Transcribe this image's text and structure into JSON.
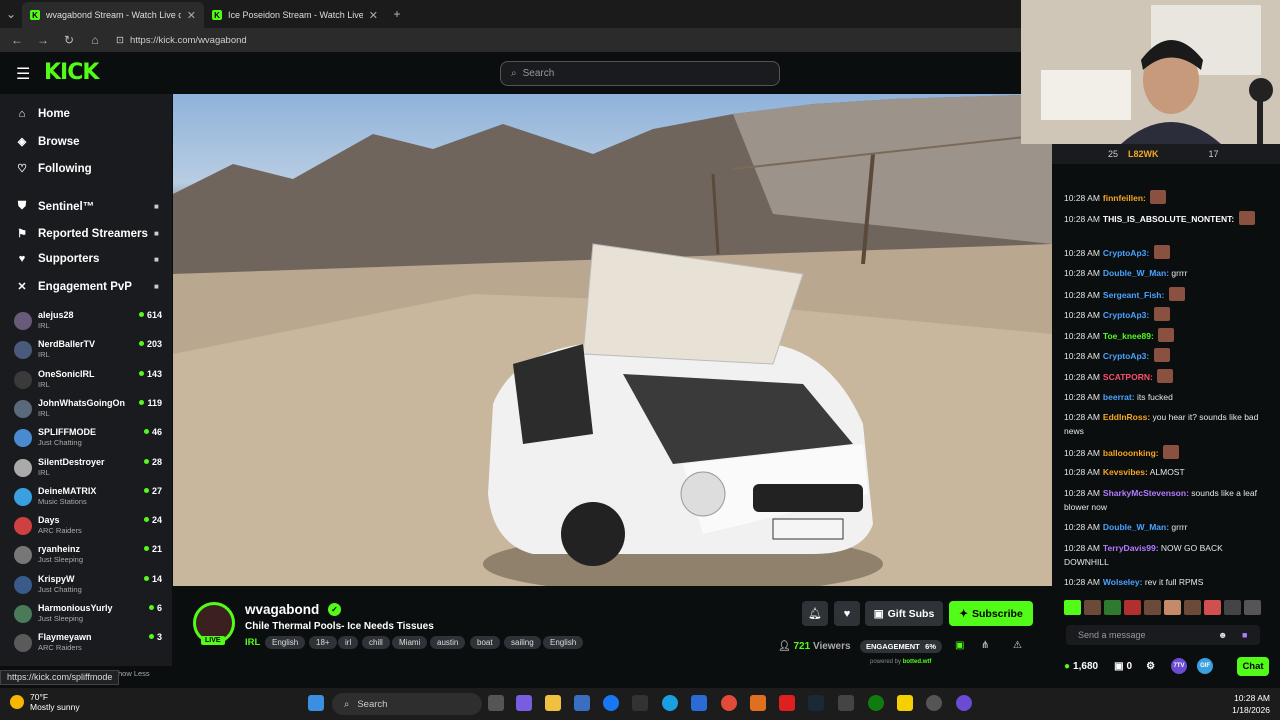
{
  "browser": {
    "tabs": [
      {
        "title": "wvagabond Stream - Watch Live on Kick",
        "active": true
      },
      {
        "title": "Ice Poseidon Stream - Watch Live on Kick",
        "active": false
      }
    ],
    "new_tab": "+",
    "url": "https://kick.com/wvagabond"
  },
  "header": {
    "logo": "KICK",
    "search_placeholder": "Search"
  },
  "sidebar": {
    "nav": [
      {
        "label": "Home",
        "icon": "home-icon"
      },
      {
        "label": "Browse",
        "icon": "compass-icon"
      },
      {
        "label": "Following",
        "icon": "heart-icon"
      }
    ],
    "extensions": [
      {
        "label": "Sentinel™",
        "icon": "shield-icon"
      },
      {
        "label": "Reported Streamers",
        "icon": "flag-icon"
      },
      {
        "label": "Supporters",
        "icon": "heart-icon"
      },
      {
        "label": "Engagement PvP",
        "icon": "swords-icon"
      }
    ],
    "channels": [
      {
        "name": "alejus28",
        "category": "IRL",
        "viewers": "614"
      },
      {
        "name": "NerdBallerTV",
        "category": "IRL",
        "viewers": "203"
      },
      {
        "name": "OneSonicIRL",
        "category": "IRL",
        "viewers": "143"
      },
      {
        "name": "JohnWhatsGoingOn",
        "category": "IRL",
        "viewers": "119"
      },
      {
        "name": "SPLIFFMODE",
        "category": "Just Chatting",
        "viewers": "46"
      },
      {
        "name": "SilentDestroyer",
        "category": "IRL",
        "viewers": "28"
      },
      {
        "name": "DeineMATRIX",
        "category": "Music Stations",
        "viewers": "27"
      },
      {
        "name": "Days",
        "category": "ARC Raiders",
        "viewers": "24"
      },
      {
        "name": "ryanheinz",
        "category": "Just Sleeping",
        "viewers": "21"
      },
      {
        "name": "KrispyW",
        "category": "Just Chatting",
        "viewers": "14"
      },
      {
        "name": "HarmoniousYurly",
        "category": "Just Sleeping",
        "viewers": "6"
      },
      {
        "name": "Flaymeyawn",
        "category": "ARC Raiders",
        "viewers": "3"
      }
    ],
    "show_less": "how Less"
  },
  "stream": {
    "streamer": "wvagabond",
    "live_badge": "LIVE",
    "title": "Chile Thermal Pools- Ice Needs Tissues",
    "category": "IRL",
    "tags": [
      "English",
      "18+",
      "irl",
      "chill",
      "Miami",
      "austin",
      "boat",
      "sailing",
      "English"
    ],
    "gift_subs_label": "Gift Subs",
    "subscribe_label": "Subscribe",
    "viewers_count": "721",
    "viewers_label": "Viewers",
    "engagement_label": "ENGAGEMENT",
    "engagement_value": "6%",
    "powered_by_prefix": "powered by",
    "powered_by_brand": "botted.wtf"
  },
  "chat": {
    "top_bar": {
      "left_count": "25",
      "top_gifter": "L82WK",
      "right_count": "17"
    },
    "messages": [
      {
        "time": "10:28 AM",
        "user": "finnfeillen:",
        "text": "",
        "color": "#f5a623"
      },
      {
        "time": "10:28 AM",
        "user": "THIS_IS_ABSOLUTE_NONTENT:",
        "text": "",
        "color": "#ffffff"
      },
      {
        "time": "10:28 AM",
        "user": "CryptoAp3:",
        "text": "",
        "color": "#4aa3ff"
      },
      {
        "time": "10:28 AM",
        "user": "Double_W_Man:",
        "text": "grrrr",
        "color": "#4aa3ff"
      },
      {
        "time": "10:28 AM",
        "user": "Sergeant_Fish:",
        "text": "",
        "color": "#4aa3ff"
      },
      {
        "time": "10:28 AM",
        "user": "CryptoAp3:",
        "text": "",
        "color": "#4aa3ff"
      },
      {
        "time": "10:28 AM",
        "user": "Toe_knee89:",
        "text": "",
        "color": "#53fc18"
      },
      {
        "time": "10:28 AM",
        "user": "CryptoAp3:",
        "text": "",
        "color": "#4aa3ff"
      },
      {
        "time": "10:28 AM",
        "user": "SCATPORN:",
        "text": "",
        "color": "#ff4d6d"
      },
      {
        "time": "10:28 AM",
        "user": "beerrat:",
        "text": "its fucked",
        "color": "#4aa3ff"
      },
      {
        "time": "10:28 AM",
        "user": "EddInRoss:",
        "text": "you hear it? sounds like bad news",
        "color": "#f5a623"
      },
      {
        "time": "10:28 AM",
        "user": "ballooonking:",
        "text": "",
        "color": "#f5a623"
      },
      {
        "time": "10:28 AM",
        "user": "Kevsvibes:",
        "text": "ALMOST",
        "color": "#f5a623"
      },
      {
        "time": "10:28 AM",
        "user": "SharkyMcStevenson:",
        "text": "sounds like a leaf blower now",
        "color": "#b57bff"
      },
      {
        "time": "10:28 AM",
        "user": "Double_W_Man:",
        "text": "grrrr",
        "color": "#4aa3ff"
      },
      {
        "time": "10:28 AM",
        "user": "TerryDavis99:",
        "text": "NOW GO BACK DOWNHILL",
        "color": "#b57bff"
      },
      {
        "time": "10:28 AM",
        "user": "Wolseley:",
        "text": "rev it full RPMS",
        "color": "#4aa3ff"
      }
    ],
    "input_placeholder": "Send a message",
    "points": "1,680",
    "second_count": "0",
    "chat_button": "Chat"
  },
  "status_url": "https://kick.com/spliffmode",
  "taskbar": {
    "weather_temp": "70°F",
    "weather_desc": "Mostly sunny",
    "search_label": "Search",
    "time": "10:28 AM",
    "date": "1/18/2026"
  },
  "colors": {
    "accent": "#53fc18",
    "bg": "#0b0e0f",
    "panel": "#191b1f"
  }
}
